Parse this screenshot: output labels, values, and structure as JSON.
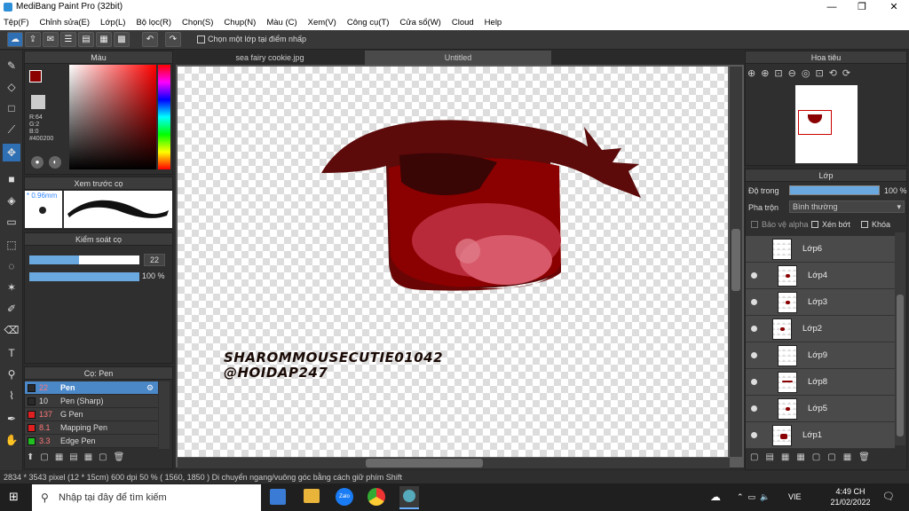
{
  "app": {
    "title": "MediBang Paint Pro (32bit)"
  },
  "menu": [
    "Tệp(F)",
    "Chỉnh sửa(E)",
    "Lớp(L)",
    "Bộ lọc(R)",
    "Chọn(S)",
    "Chụp(N)",
    "Màu (C)",
    "Xem(V)",
    "Công cụ(T)",
    "Cửa sổ(W)",
    "Cloud",
    "Help"
  ],
  "toolbar": {
    "checkbox_label": "Chọn một lớp tại điểm nhấp"
  },
  "color_panel": {
    "title": "Màu",
    "r": "R:64",
    "g": "G:2",
    "b": "B:0",
    "hex": "#400200",
    "fg": "#8b0000",
    "bg": "#ffffff"
  },
  "preview_panel": {
    "title": "Xem trước cọ",
    "size": "* 0.96mm"
  },
  "brush_control": {
    "title": "Kiểm soát cọ",
    "size": "22",
    "opacity": "100 %",
    "size_fraction": 0.45,
    "opacity_fraction": 1.0
  },
  "brush_panel": {
    "title": "Cọ: Pen",
    "items": [
      {
        "size": "22",
        "name": "Pen",
        "color": "#2a2a2a"
      },
      {
        "size": "10",
        "name": "Pen (Sharp)",
        "color": "#2a2a2a"
      },
      {
        "size": "137",
        "name": "G Pen",
        "color": "#e02020"
      },
      {
        "size": "8.1",
        "name": "Mapping Pen",
        "color": "#e02020"
      },
      {
        "size": "3.3",
        "name": "Edge Pen",
        "color": "#20c020"
      }
    ]
  },
  "tabs": [
    "sea fairy cookie.jpg",
    "Untitled"
  ],
  "canvas_text": {
    "line1": "SHAROMMOUSECUTIE01042",
    "line2": "@HOIDAP247"
  },
  "navigator": {
    "title": "Hoa tiêu"
  },
  "layers_panel": {
    "title": "Lớp",
    "opacity_label": "Độ trong",
    "opacity_value": "100 %",
    "blend_label": "Pha trộn",
    "blend_value": "Bình thường",
    "protect_alpha": "Bảo vệ alpha",
    "clipping": "Xén bớt",
    "lock": "Khóa",
    "layers": [
      "Lớp6",
      "Lớp4",
      "Lớp3",
      "Lớp2",
      "Lớp9",
      "Lớp8",
      "Lớp5",
      "Lớp1"
    ]
  },
  "status": {
    "text": "2834 * 3543 pixel   (12 * 15cm)   600 dpi   50 %   ( 1560, 1850 )   Di chuyển ngang/vuông góc bằng cách giữ phím Shift"
  },
  "taskbar": {
    "search_placeholder": "Nhập tại đây để tìm kiếm",
    "time": "4:49 CH",
    "date": "21/02/2022",
    "lang": "VIE"
  }
}
